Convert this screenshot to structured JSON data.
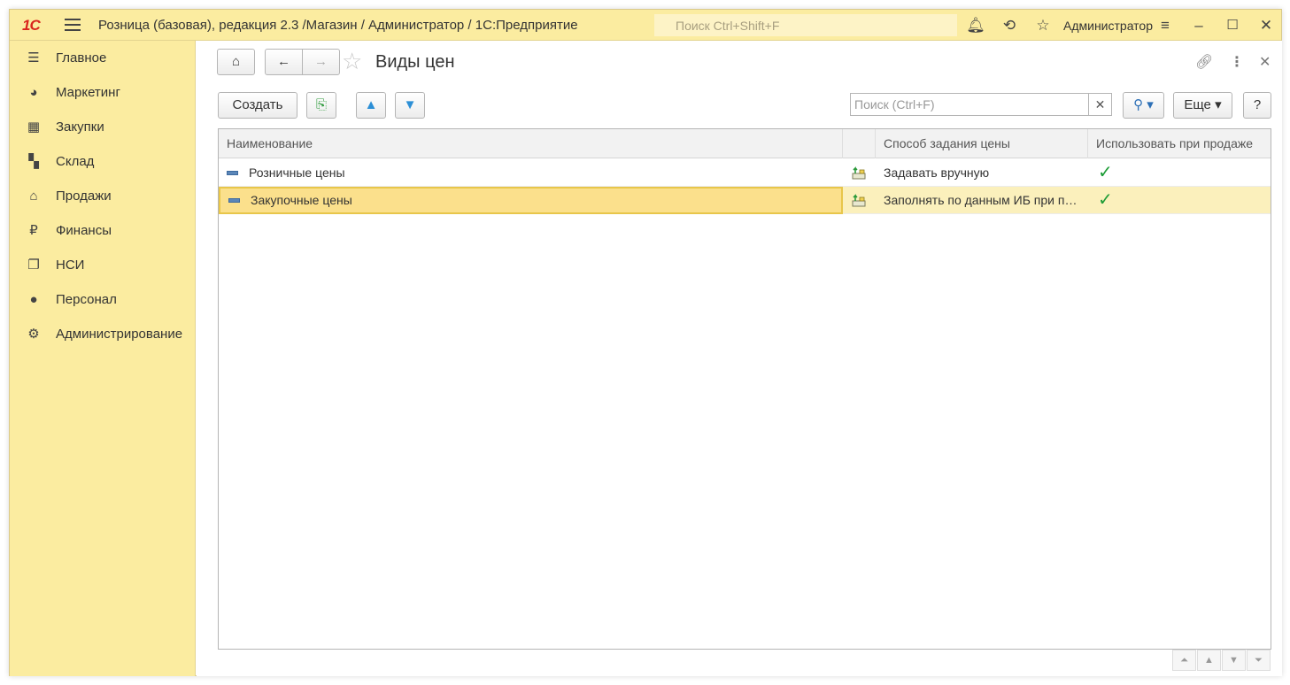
{
  "titlebar": {
    "logo": "1С",
    "app_title": "Розница (базовая), редакция 2.3 /Магазин / Администратор / 1С:Предприятие",
    "search_placeholder": "Поиск Ctrl+Shift+F",
    "user": "Администратор"
  },
  "sidebar": {
    "items": [
      {
        "label": "Главное",
        "icon": "menu-icon"
      },
      {
        "label": "Маркетинг",
        "icon": "pie-chart-icon"
      },
      {
        "label": "Закупки",
        "icon": "cart-icon"
      },
      {
        "label": "Склад",
        "icon": "warehouse-icon"
      },
      {
        "label": "Продажи",
        "icon": "basket-icon"
      },
      {
        "label": "Финансы",
        "icon": "ruble-icon"
      },
      {
        "label": "НСИ",
        "icon": "documents-icon"
      },
      {
        "label": "Персонал",
        "icon": "person-icon"
      },
      {
        "label": "Администрирование",
        "icon": "gear-icon"
      }
    ]
  },
  "form": {
    "title": "Виды цен",
    "create_label": "Создать",
    "search_placeholder": "Поиск (Ctrl+F)",
    "more_label": "Еще",
    "help_label": "?"
  },
  "table": {
    "columns": [
      "Наименование",
      "",
      "Способ задания цены",
      "Использовать при продаже"
    ],
    "rows": [
      {
        "name": "Розничные цены",
        "method": "Задавать вручную",
        "use_in_sales": true,
        "selected": false
      },
      {
        "name": "Закупочные цены",
        "method": "Заполнять по данным ИБ при поступлении",
        "use_in_sales": true,
        "selected": true
      }
    ]
  }
}
